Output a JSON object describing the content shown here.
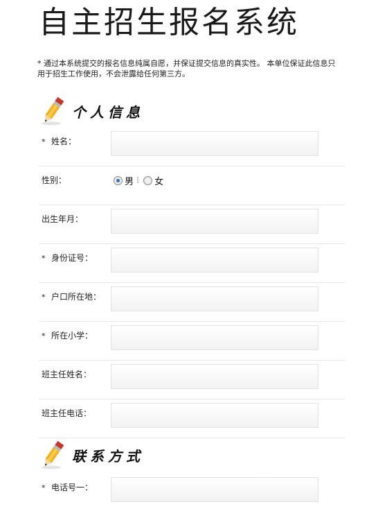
{
  "header": {
    "title": "自主招生报名系统"
  },
  "notice": {
    "required_mark": "*",
    "text": "通过本系统提交的报名信息纯属自愿，并保证提交信息的真实性。 本单位保证此信息只用于招生工作使用，不会泄露给任何第三方。"
  },
  "sections": {
    "personal": {
      "title": "个人信息",
      "icon": "pencil-icon"
    },
    "contact": {
      "title": "联系方式",
      "icon": "pencil-icon"
    }
  },
  "fields": {
    "required_mark": "*",
    "name": {
      "label": "姓名：",
      "value": ""
    },
    "gender": {
      "label": "性别：",
      "options": [
        "男",
        "女"
      ],
      "selected": "男",
      "separator": "⁞"
    },
    "birth": {
      "label": "出生年月：",
      "value": ""
    },
    "id_number": {
      "label": "身份证号：",
      "value": ""
    },
    "household": {
      "label": "户口所在地：",
      "value": ""
    },
    "school": {
      "label": "所在小学：",
      "value": ""
    },
    "teacher_name": {
      "label": "班主任姓名：",
      "value": ""
    },
    "teacher_phone": {
      "label": "班主任电话：",
      "value": ""
    },
    "phone1": {
      "label": "电话号一：",
      "value": ""
    }
  },
  "colors": {
    "radio_checked": "#2b6fb7",
    "pencil_body": "#f0b323",
    "pencil_eraser": "#c0392b"
  }
}
